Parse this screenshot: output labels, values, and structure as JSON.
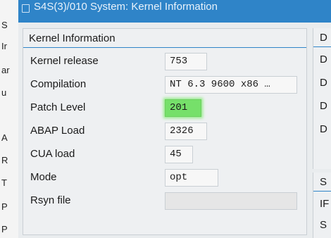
{
  "window": {
    "title": "S4S(3)/010 System: Kernel Information"
  },
  "background_letters": [
    "S",
    "Ir",
    "ar",
    "u",
    "A",
    "R",
    "T",
    "P",
    "P"
  ],
  "kernel_panel": {
    "title": "Kernel Information",
    "rows": [
      {
        "label": "Kernel release",
        "value": "753"
      },
      {
        "label": "Compilation",
        "value": "NT 6.3 9600 x86 …"
      },
      {
        "label": "Patch Level",
        "value": "201",
        "highlighted": true
      },
      {
        "label": "ABAP Load",
        "value": "2326"
      },
      {
        "label": "CUA load",
        "value": "45"
      },
      {
        "label": "Mode",
        "value": "opt"
      },
      {
        "label": "Rsyn file",
        "value": ""
      }
    ]
  },
  "right_panel_top": {
    "title": "D",
    "items": [
      "D",
      "D",
      "D",
      "D"
    ]
  },
  "right_panel_bottom": {
    "title": "S",
    "items": [
      "IF",
      "S"
    ]
  },
  "colors": {
    "title_bar": "#2f84c8",
    "highlight": "#76e06a",
    "panel_accent": "#2f84c8"
  }
}
